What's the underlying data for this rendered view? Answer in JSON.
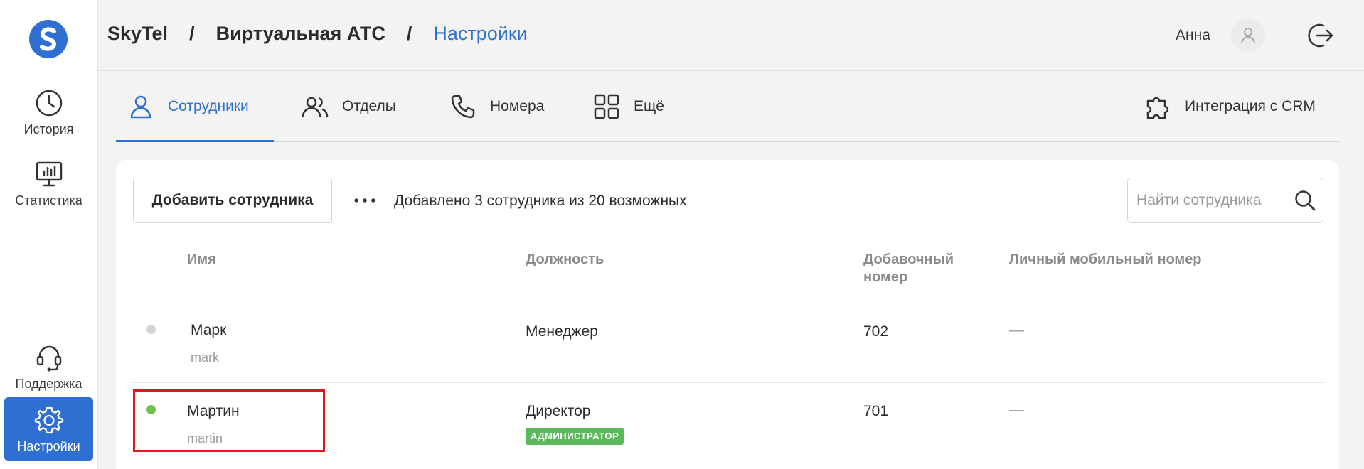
{
  "sidebar": {
    "items": [
      {
        "label": "История",
        "icon": "clock-icon"
      },
      {
        "label": "Статистика",
        "icon": "statistics-monitor-icon"
      },
      {
        "label": "Поддержка",
        "icon": "headset-icon"
      },
      {
        "label": "Настройки",
        "icon": "gear-icon",
        "active": true
      }
    ]
  },
  "header": {
    "breadcrumb": [
      "SkyTel",
      "Виртуальная АТС",
      "Настройки"
    ],
    "separator": "/",
    "user_name": "Анна"
  },
  "tabs": [
    {
      "label": "Сотрудники",
      "icon": "user-icon",
      "active": true
    },
    {
      "label": "Отделы",
      "icon": "users-icon"
    },
    {
      "label": "Номера",
      "icon": "phone-icon"
    },
    {
      "label": "Ещё",
      "icon": "grid-icon"
    },
    {
      "label": "Интеграция с CRM",
      "icon": "puzzle-icon"
    }
  ],
  "toolbar": {
    "add_label": "Добавить сотрудника",
    "count_text": "Добавлено 3 сотрудника из 20 возможных",
    "search_placeholder": "Найти сотрудника"
  },
  "table": {
    "columns": [
      "Имя",
      "Должность",
      "Добавочный номер",
      "Личный мобильный номер"
    ],
    "rows": [
      {
        "name": "Марк",
        "login": "mark",
        "position": "Менеджер",
        "ext": "702",
        "mobile": "—",
        "status": "offline",
        "badge": ""
      },
      {
        "name": "Мартин",
        "login": "martin",
        "position": "Директор",
        "ext": "701",
        "mobile": "—",
        "status": "online",
        "badge": "АДМИНИСТРАТОР"
      }
    ]
  },
  "colors": {
    "accent": "#2f6fd1",
    "online": "#6cc24a",
    "offline": "#d4d4d4",
    "badge": "#5cb85c",
    "highlight": "#e8141b"
  }
}
